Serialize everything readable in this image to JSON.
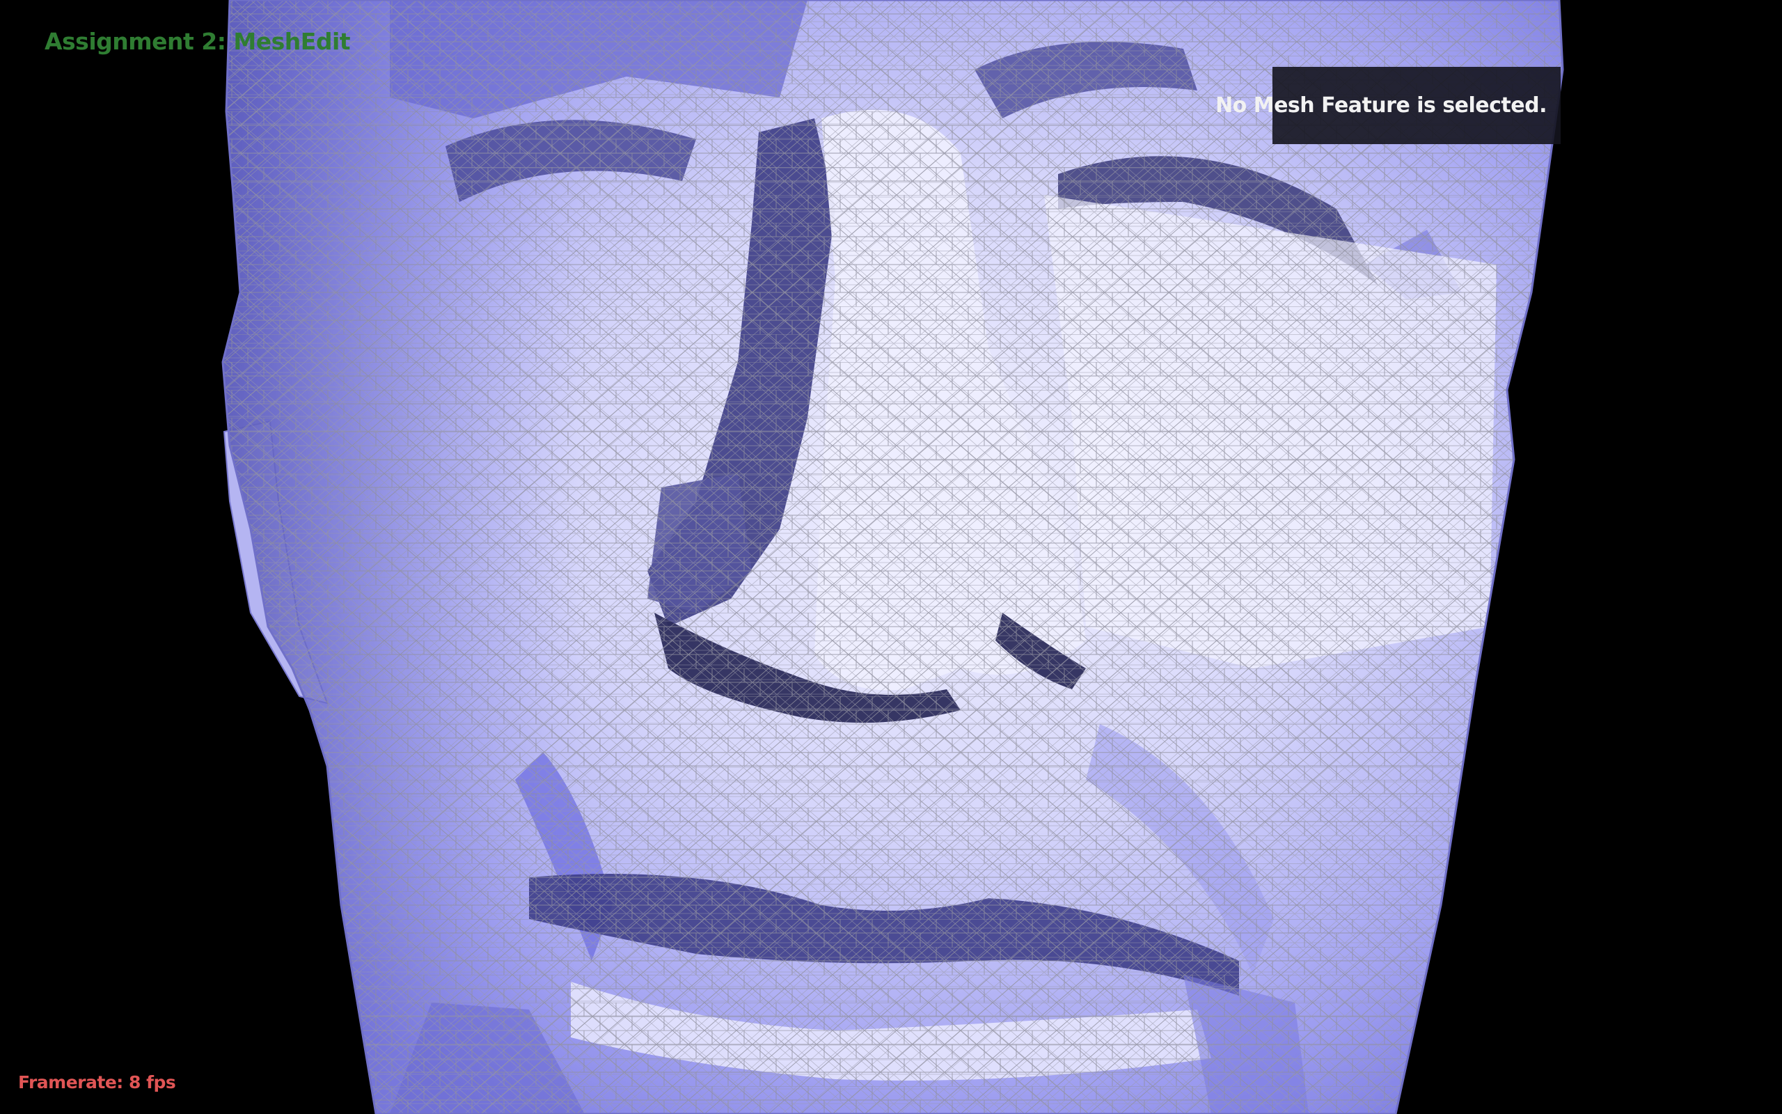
{
  "app": {
    "title": "Assignment 2: MeshEdit"
  },
  "info_panel": {
    "message": "No Mesh Feature is selected."
  },
  "status": {
    "framerate_label": "Framerate: 8 fps",
    "framerate_value": 8
  },
  "viewport": {
    "background_color": "#000000",
    "mesh_base_color": "#8c8cf0",
    "mesh_highlight_color": "#f4f4ff",
    "mesh_shadow_color": "#3a3a78",
    "wireframe_color": "#9a9a9a",
    "rendered_object": "3D triangle mesh of a human head (close-up on nose and mouth)"
  },
  "colors": {
    "title": "#2f7d32",
    "framerate": "#e05555",
    "panel_text": "#f2f2f2"
  }
}
